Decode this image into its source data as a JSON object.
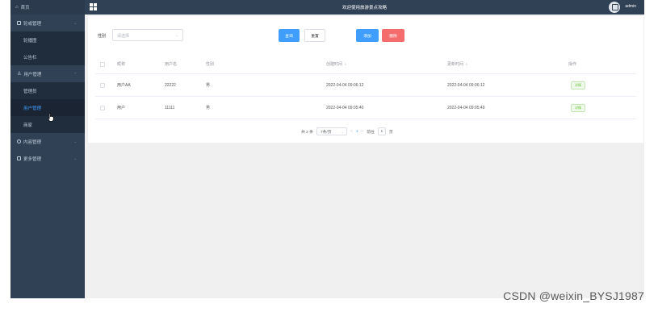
{
  "topbar": {
    "title": "欢迎使用旅游景点攻略",
    "username": "admin"
  },
  "sidebar": {
    "home": "首页",
    "groups": [
      {
        "label": "轮或管理",
        "children": [
          "轮播图",
          "公告栏"
        ]
      },
      {
        "label": "用户管理",
        "children": [
          "管理员",
          "用户管理",
          "商家"
        ]
      },
      {
        "label": "内容管理",
        "children": []
      },
      {
        "label": "更多管理",
        "children": []
      }
    ]
  },
  "filters": {
    "gender_label": "性别",
    "gender_placeholder": "请选择"
  },
  "buttons": {
    "search": "查询",
    "reset": "重置",
    "add": "添加",
    "delete": "删除"
  },
  "table": {
    "headers": [
      "昵称",
      "用户名",
      "性别",
      "创建时间",
      "更新时间",
      "操作"
    ],
    "rows": [
      {
        "nickname": "用户AA",
        "username": "22222",
        "gender": "男",
        "created": "2022-04-04 09:06:12",
        "updated": "2022-04-04 09:06:12",
        "action": "详情"
      },
      {
        "nickname": "用户",
        "username": "11111",
        "gender": "男",
        "created": "2022-04-04 09:05:40",
        "updated": "2022-04-04 09:05:49",
        "action": "详情"
      }
    ]
  },
  "pagination": {
    "total": "共 2 条",
    "page_size": "7条/页",
    "prev": "<",
    "current_page": "1",
    "next": ">",
    "goto_prefix": "前往",
    "goto_value": "1",
    "goto_suffix": "页"
  },
  "watermark": "CSDN @weixin_BYSJ1987"
}
